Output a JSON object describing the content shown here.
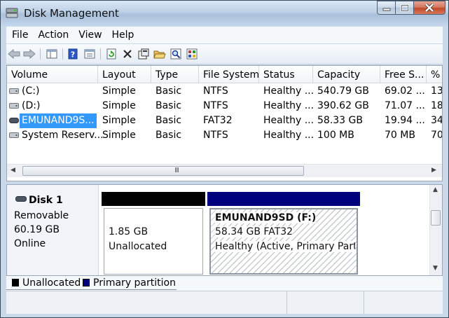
{
  "window": {
    "title": "Disk Management",
    "icon": "disk-management-icon",
    "controls": [
      "minimize-icon",
      "maximize-icon",
      "close-icon"
    ]
  },
  "menu": [
    "File",
    "Action",
    "View",
    "Help"
  ],
  "toolbar": [
    "back-arrow-icon",
    "forward-arrow-icon",
    "console-tree-icon",
    "help-icon",
    "properties-icon",
    "refresh-icon",
    "delete-icon",
    "disk-properties-icon",
    "open-folder-icon",
    "find-icon",
    "settings-icon"
  ],
  "volumes": {
    "columns": [
      "Volume",
      "Layout",
      "Type",
      "File System",
      "Status",
      "Capacity",
      "Free S...",
      "%"
    ],
    "rows": [
      {
        "name": "(C:)",
        "layout": "Simple",
        "type": "Basic",
        "fs": "NTFS",
        "status": "Healthy ...",
        "capacity": "540.79 GB",
        "free": "69.02 ...",
        "pct": "13"
      },
      {
        "name": "(D:)",
        "layout": "Simple",
        "type": "Basic",
        "fs": "NTFS",
        "status": "Healthy ...",
        "capacity": "390.62 GB",
        "free": "71.07 ...",
        "pct": "18"
      },
      {
        "name": "EMUNAND9S...",
        "layout": "Simple",
        "type": "Basic",
        "fs": "FAT32",
        "status": "Healthy ...",
        "capacity": "58.33 GB",
        "free": "19.94 ...",
        "pct": "34"
      },
      {
        "name": "System Reserv...",
        "layout": "Simple",
        "type": "Basic",
        "fs": "NTFS",
        "status": "Healthy ...",
        "capacity": "100 MB",
        "free": "70 MB",
        "pct": "70"
      }
    ],
    "selected_row": 2,
    "scroll_grip": "III"
  },
  "disk": {
    "name": "Disk 1",
    "kind": "Removable",
    "size": "60.19 GB",
    "state": "Online",
    "partitions": [
      {
        "size": "1.85 GB",
        "label": "Unallocated",
        "bar_color": "#000000"
      },
      {
        "title": "EMUNAND9SD  (F:)",
        "size_fs": "58.34 GB FAT32",
        "status": "Healthy (Active, Primary Partitio",
        "bar_color": "#00007f"
      }
    ]
  },
  "legend": [
    {
      "label": "Unallocated",
      "color": "#000000"
    },
    {
      "label": "Primary partition",
      "color": "#00007f"
    }
  ],
  "colors": {
    "selection": "#3399ff",
    "titlebar": "#bcd0e6"
  }
}
